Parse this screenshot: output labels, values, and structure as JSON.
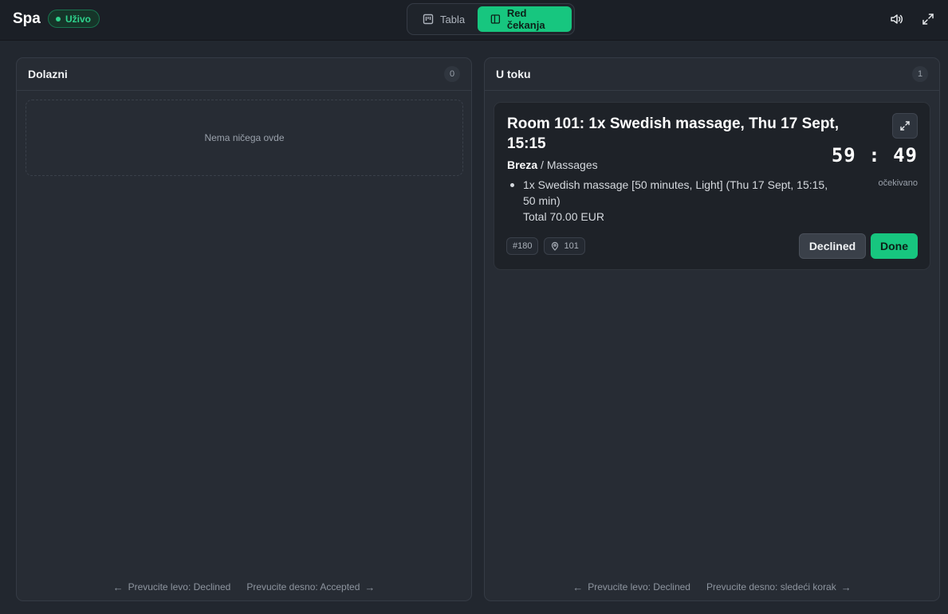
{
  "header": {
    "brand": "Spa",
    "live_badge": "Uživo",
    "view_toggle": {
      "board_label": "Tabla",
      "queue_label": "Red čekanja",
      "active": "queue"
    },
    "icons": [
      "speaker-icon",
      "fullscreen-icon"
    ]
  },
  "columns": [
    {
      "title": "Dolazni",
      "count": "0",
      "empty_text": "Nema ničega ovde",
      "footer_left": "Prevucite levo: Declined",
      "footer_right": "Prevucite desno: Accepted"
    },
    {
      "title": "U toku",
      "count": "1",
      "footer_left": "Prevucite levo: Declined",
      "footer_right": "Prevucite desno: sledeći korak",
      "card": {
        "title": "Room 101: 1x Swedish massage, Thu 17 Sept, 15:15",
        "location": "Breza",
        "separator": " / ",
        "category": "Massages",
        "item_line": "1x Swedish massage [50 minutes, Light] (Thu 17 Sept, 15:15, 50 min)",
        "total": "Total 70.00 EUR",
        "timer": "59 : 49",
        "timer_label": "očekivano",
        "order_id": "#180",
        "room": "101",
        "declined_label": "Declined",
        "done_label": "Done"
      }
    }
  ],
  "colors": {
    "accent": "#17c67f",
    "background": "#22272f",
    "panel": "#272c34",
    "card": "#1e2228"
  }
}
